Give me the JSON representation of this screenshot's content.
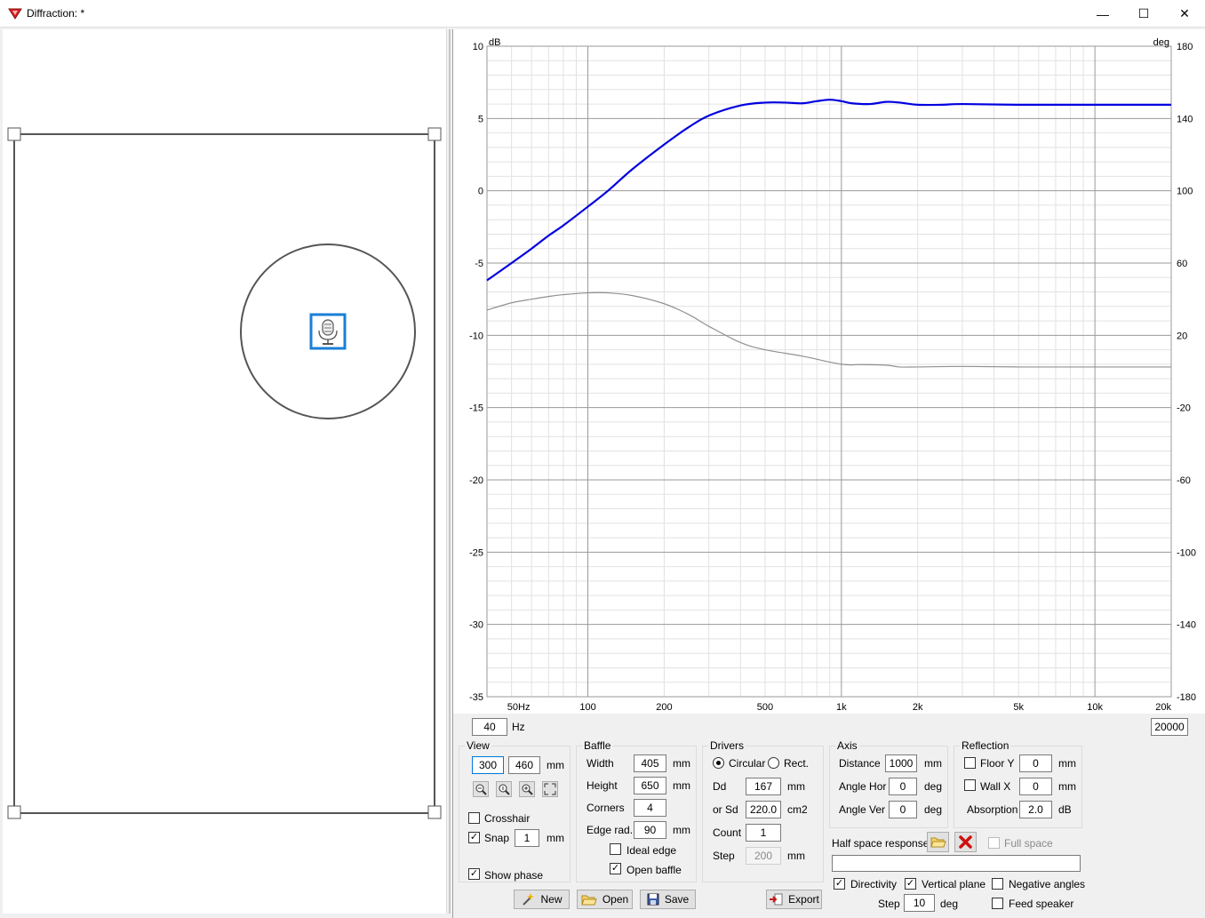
{
  "window": {
    "title": "Diffraction: *",
    "controls": {
      "minimize": "—",
      "maximize": "☐",
      "close": "✕"
    }
  },
  "chart": {
    "left_unit": "dB",
    "right_unit": "deg",
    "left_ticks": [
      "10",
      "5",
      "0",
      "-5",
      "-10",
      "-15",
      "-20",
      "-25",
      "-30",
      "-35"
    ],
    "right_ticks": [
      "180",
      "140",
      "100",
      "60",
      "20",
      "-20",
      "-60",
      "-100",
      "-140",
      "-180"
    ],
    "x_ticks": [
      "50Hz",
      "100",
      "200",
      "500",
      "1k",
      "2k",
      "5k",
      "10k",
      "20k"
    ],
    "freq_min": "40",
    "freq_max": "20000",
    "hz_label": "Hz"
  },
  "chart_data": {
    "type": "line",
    "title": "",
    "xlabel": "",
    "ylabel": "dB",
    "y2label": "deg",
    "x_scale": "log",
    "xlim": [
      40,
      20000
    ],
    "ylim": [
      -35,
      10
    ],
    "y2lim": [
      -180,
      180
    ],
    "grid": true,
    "series": [
      {
        "axis": "left",
        "color": "#0000e0",
        "points": [
          [
            40,
            -6.2
          ],
          [
            50,
            -5
          ],
          [
            60,
            -4
          ],
          [
            70,
            -3.1
          ],
          [
            80,
            -2.4
          ],
          [
            100,
            -1.1
          ],
          [
            120,
            0
          ],
          [
            150,
            1.5
          ],
          [
            200,
            3.2
          ],
          [
            250,
            4.4
          ],
          [
            300,
            5.2
          ],
          [
            400,
            5.9
          ],
          [
            500,
            6.1
          ],
          [
            600,
            6.1
          ],
          [
            700,
            6.05
          ],
          [
            800,
            6.2
          ],
          [
            900,
            6.3
          ],
          [
            1000,
            6.2
          ],
          [
            1100,
            6.05
          ],
          [
            1300,
            6.0
          ],
          [
            1500,
            6.15
          ],
          [
            1700,
            6.1
          ],
          [
            2000,
            5.95
          ],
          [
            2500,
            5.95
          ],
          [
            3000,
            6.0
          ],
          [
            5000,
            5.95
          ],
          [
            10000,
            5.95
          ],
          [
            20000,
            5.95
          ]
        ]
      },
      {
        "axis": "right",
        "color": "#909090",
        "points": [
          [
            40,
            34
          ],
          [
            50,
            38
          ],
          [
            60,
            40
          ],
          [
            70,
            41.5
          ],
          [
            80,
            42.5
          ],
          [
            100,
            43.5
          ],
          [
            120,
            43.5
          ],
          [
            150,
            42
          ],
          [
            200,
            37.5
          ],
          [
            250,
            31.5
          ],
          [
            300,
            25
          ],
          [
            400,
            16
          ],
          [
            500,
            12
          ],
          [
            700,
            8.5
          ],
          [
            1000,
            4
          ],
          [
            1200,
            3.8
          ],
          [
            1500,
            3.5
          ],
          [
            1700,
            2.5
          ],
          [
            2000,
            2.5
          ],
          [
            3000,
            2.8
          ],
          [
            5000,
            2.5
          ],
          [
            10000,
            2.5
          ],
          [
            20000,
            2.5
          ]
        ]
      }
    ]
  },
  "view_group": {
    "title": "View",
    "width": "300",
    "height": "460",
    "unit": "mm",
    "crosshair_label": "Crosshair",
    "snap_label": "Snap",
    "snap_value": "1",
    "show_phase_label": "Show phase"
  },
  "baffle_group": {
    "title": "Baffle",
    "width_label": "Width",
    "width": "405",
    "height_label": "Height",
    "height": "650",
    "corners_label": "Corners",
    "corners": "4",
    "edge_rad_label": "Edge rad.",
    "edge_rad": "90",
    "unit": "mm",
    "ideal_edge_label": "Ideal edge",
    "open_baffle_label": "Open baffle"
  },
  "drivers_group": {
    "title": "Drivers",
    "circular_label": "Circular",
    "rect_label": "Rect.",
    "dd_label": "Dd",
    "dd": "167",
    "dd_unit": "mm",
    "sd_label": "or Sd",
    "sd": "220.0",
    "sd_unit": "cm2",
    "count_label": "Count",
    "count": "1",
    "step_label": "Step",
    "step": "200",
    "step_unit": "mm"
  },
  "axis_group": {
    "title": "Axis",
    "distance_label": "Distance",
    "distance": "1000",
    "distance_unit": "mm",
    "angle_hor_label": "Angle Hor",
    "angle_hor": "0",
    "angle_ver_label": "Angle Ver",
    "angle_ver": "0",
    "deg_unit": "deg"
  },
  "reflection_group": {
    "title": "Reflection",
    "floor_label": "Floor Y",
    "floor": "0",
    "wall_label": "Wall  X",
    "wall": "0",
    "mm_unit": "mm",
    "absorption_label": "Absorption",
    "absorption": "2.0",
    "db_unit": "dB"
  },
  "half_space": {
    "label": "Half space response",
    "full_space_label": "Full space",
    "path": ""
  },
  "bottom_options": {
    "directivity_label": "Directivity",
    "vertical_plane_label": "Vertical plane",
    "negative_angles_label": "Negative angles",
    "step_label": "Step",
    "step": "10",
    "deg_unit": "deg",
    "feed_speaker_label": "Feed speaker"
  },
  "buttons": {
    "new": "New",
    "open": "Open",
    "save": "Save",
    "export": "Export"
  },
  "colors": {
    "magnitude": "#0000e0",
    "phase": "#909090",
    "baffle_outline": "#555555",
    "mic_highlight": "#1a7fd6"
  },
  "icons": {
    "app": "diffraction-app-icon",
    "microphone": "microphone-icon",
    "zoom_out": "zoom-out-icon",
    "zoom_reset": "zoom-reset-icon",
    "zoom_in": "zoom-in-icon",
    "fit": "fit-view-icon",
    "open_folder": "open-folder-icon",
    "delete": "delete-icon",
    "new": "new-wand-icon",
    "save": "save-floppy-icon",
    "export": "export-icon"
  }
}
